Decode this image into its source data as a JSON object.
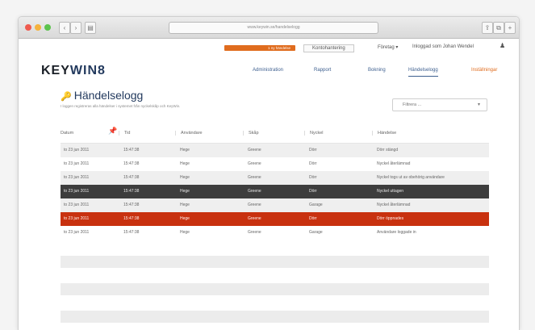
{
  "browser": {
    "url": "www.keywin.se/handelselogg",
    "dots": [
      "#ef5a4e",
      "#f5b23d",
      "#5cc34d"
    ],
    "back_label": "‹",
    "forward_label": "›",
    "sidebar_label": "▤",
    "share_label": "⇪",
    "tab_label": "⧉",
    "plus_label": "+"
  },
  "topbar": {
    "notice_badge": "1 ny händelse",
    "language": "Kontohantering",
    "account_menu": "Företag ▾",
    "user": "Inloggad som Johan Wendel",
    "user_icon": "user-icon"
  },
  "brand": {
    "left": "KEY",
    "right": "WIN",
    "suffix": "8"
  },
  "nav": [
    {
      "label": "Administration",
      "state": "normal"
    },
    {
      "label": "Rapport",
      "state": "normal"
    },
    {
      "label": "Bokning",
      "state": "normal"
    },
    {
      "label": "Händelselogg",
      "state": "active"
    },
    {
      "label": "Inställningar",
      "state": "alert"
    }
  ],
  "page": {
    "title": "Händelselogg",
    "title_icon": "key-icon",
    "subtitle": "I loggen registreras alla händelser i systemet från nyckelskåp och KeyWin.",
    "filter": {
      "value": "Filtrera ...",
      "icon": "chevron-down-icon"
    }
  },
  "table": {
    "columns": [
      "Datum",
      "Tid",
      "Användare",
      "Skåp",
      "Nyckel",
      "Händelse"
    ],
    "sort_icon": "pin-icon",
    "rows": [
      {
        "datum": "to 23 jun 2011",
        "tid": "15:47:38",
        "anvandare": "Hege",
        "skap": "Greene",
        "nyckel": "Dörr",
        "handelse": "Dörr stängd",
        "style": "odd"
      },
      {
        "datum": "to 23 jun 2011",
        "tid": "15:47:38",
        "anvandare": "Hege",
        "skap": "Greene",
        "nyckel": "Dörr",
        "handelse": "Nyckel återlämnad",
        "style": "even"
      },
      {
        "datum": "to 23 jun 2011",
        "tid": "15:47:38",
        "anvandare": "Hege",
        "skap": "Greene",
        "nyckel": "Dörr",
        "handelse": "Nyckel togs ut av obehörig användare",
        "style": "odd"
      },
      {
        "datum": "to 23 jun 2011",
        "tid": "15:47:38",
        "anvandare": "Hege",
        "skap": "Greene",
        "nyckel": "Dörr",
        "handelse": "Nyckel uttagen",
        "style": "dark"
      },
      {
        "datum": "to 23 jun 2011",
        "tid": "15:47:38",
        "anvandare": "Hege",
        "skap": "Greene",
        "nyckel": "Garage",
        "handelse": "Nyckel återlämnad",
        "style": "odd"
      },
      {
        "datum": "to 23 jun 2011",
        "tid": "15:47:38",
        "anvandare": "Hege",
        "skap": "Greene",
        "nyckel": "Dörr",
        "handelse": "Dörr öppnades",
        "style": "red"
      },
      {
        "datum": "to 23 jun 2011",
        "tid": "15:47:38",
        "anvandare": "Hege",
        "skap": "Greene",
        "nyckel": "Garage",
        "handelse": "Användare loggade in",
        "style": "even"
      }
    ]
  },
  "colors": {
    "brand_navy": "#233a5e",
    "accent_orange": "#e06c1e",
    "alert_red": "#c8310f",
    "selected_dark": "#3d3d3d"
  }
}
